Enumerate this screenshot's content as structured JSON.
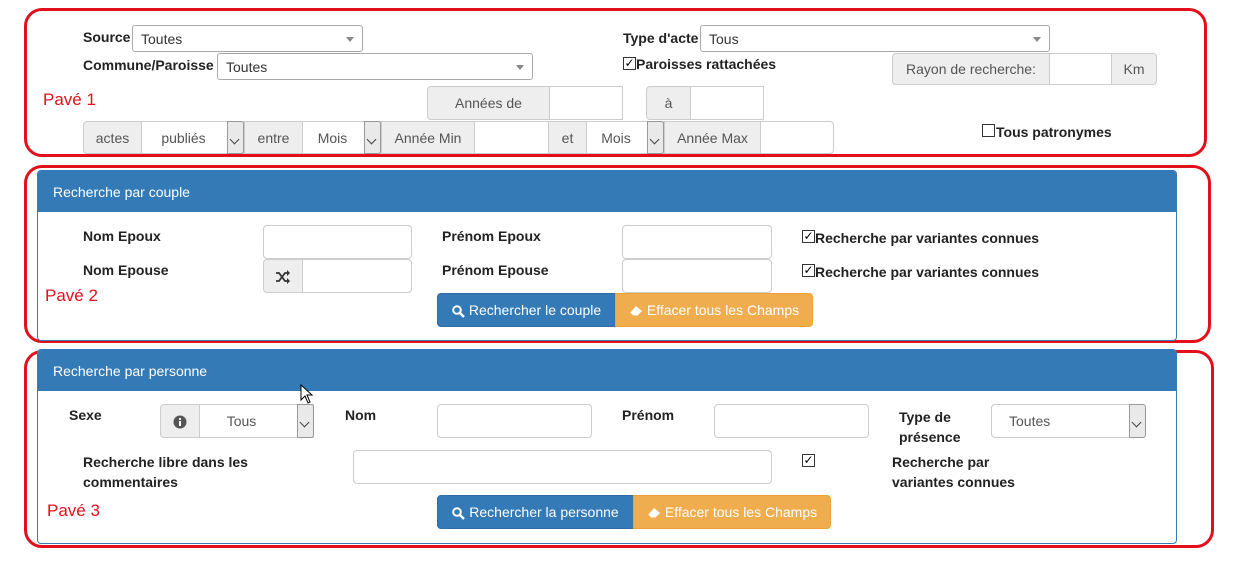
{
  "pave1": {
    "label": "Pavé 1",
    "source_label": "Source",
    "source_value": "Toutes",
    "commune_label": "Commune/Paroisse",
    "commune_value": "Toutes",
    "type_acte_label": "Type d'acte",
    "type_acte_value": "Tous",
    "paroisses_label": "Paroisses rattachées",
    "paroisses_checked": true,
    "rayon_label": "Rayon de recherche:",
    "rayon_unit": "Km",
    "annees_de_label": "Années de",
    "a_label": "à",
    "actes_label": "actes",
    "publies_value": "publiés",
    "entre_label": "entre",
    "mois1_value": "Mois",
    "annee_min_label": "Année Min",
    "et_label": "et",
    "mois2_value": "Mois",
    "annee_max_label": "Année Max",
    "tous_patronymes_label": "Tous patronymes",
    "tous_patronymes_checked": false
  },
  "pave2": {
    "label": "Pavé 2",
    "title": "Recherche par couple",
    "nom_epoux_label": "Nom Epoux",
    "nom_epouse_label": "Nom Epouse",
    "prenom_epoux_label": "Prénom Epoux",
    "prenom_epouse_label": "Prénom Epouse",
    "variantes1_label": "Recherche par variantes connues",
    "variantes2_label": "Recherche par variantes connues",
    "search_button": "Rechercher le couple",
    "clear_button": "Effacer tous les Champs"
  },
  "pave3": {
    "label": "Pavé 3",
    "title": "Recherche par personne",
    "sexe_label": "Sexe",
    "sexe_value": "Tous",
    "nom_label": "Nom",
    "prenom_label": "Prénom",
    "type_presence_label_1": "Type de",
    "type_presence_label_2": "présence",
    "type_presence_value": "Toutes",
    "libre_label_1": "Recherche libre dans les",
    "libre_label_2": "commentaires",
    "variantes_label_1": "Recherche par",
    "variantes_label_2": "variantes connues",
    "search_button": "Rechercher la personne",
    "clear_button": "Effacer tous les Champs"
  },
  "colors": {
    "annotation": "#e3101c",
    "primary": "#337ab7",
    "warning": "#f0ad4e"
  }
}
